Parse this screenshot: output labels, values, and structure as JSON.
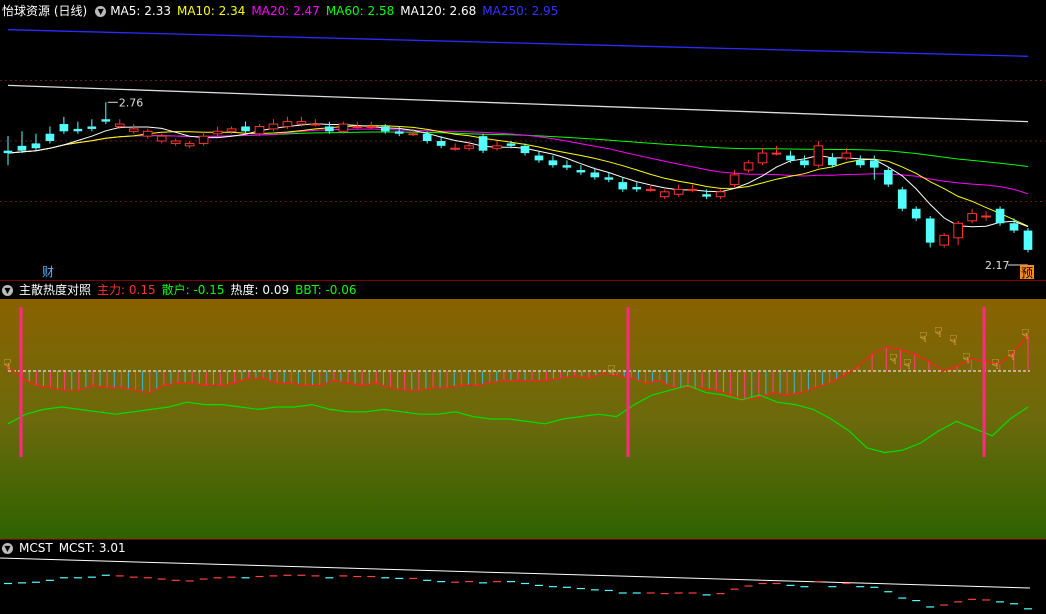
{
  "main": {
    "title": "怡球资源 (日线)",
    "ma": [
      {
        "label": "MA5: 2.33",
        "color": "#ffffff"
      },
      {
        "label": "MA10: 2.34",
        "color": "#ffff00"
      },
      {
        "label": "MA20: 2.47",
        "color": "#ff00ff"
      },
      {
        "label": "MA60: 2.58",
        "color": "#00ff00"
      },
      {
        "label": "MA120: 2.68",
        "color": "#ffffff"
      },
      {
        "label": "MA250: 2.95",
        "color": "#3333ff"
      }
    ],
    "high_label": "2.76",
    "low_label": "2.17",
    "fin_badge": "财",
    "pre_badge": "预"
  },
  "indicator": {
    "title": "主散热度对照",
    "items": [
      {
        "label": "主力: 0.15",
        "color": "#ff3333"
      },
      {
        "label": "散户: -0.15",
        "color": "#00ff00"
      },
      {
        "label": "热度: 0.09",
        "color": "#ffffff"
      },
      {
        "label": "BBT: -0.06",
        "color": "#00ff00"
      }
    ]
  },
  "mcst": {
    "title": "MCST",
    "value_label": "MCST: 3.01"
  },
  "chart_data": [
    {
      "type": "candlestick",
      "title": "怡球资源 (日线)",
      "ylim": [
        2.1,
        3.1
      ],
      "candles": [
        [
          2.56,
          2.55,
          2.62,
          2.5
        ],
        [
          2.58,
          2.56,
          2.64,
          2.55
        ],
        [
          2.59,
          2.57,
          2.63,
          2.56
        ],
        [
          2.63,
          2.6,
          2.66,
          2.59
        ],
        [
          2.67,
          2.64,
          2.7,
          2.63
        ],
        [
          2.65,
          2.64,
          2.68,
          2.63
        ],
        [
          2.66,
          2.65,
          2.69,
          2.64
        ],
        [
          2.69,
          2.68,
          2.76,
          2.67
        ],
        [
          2.66,
          2.67,
          2.69,
          2.65
        ],
        [
          2.64,
          2.65,
          2.67,
          2.63
        ],
        [
          2.62,
          2.64,
          2.65,
          2.61
        ],
        [
          2.6,
          2.62,
          2.63,
          2.59
        ],
        [
          2.59,
          2.6,
          2.61,
          2.58
        ],
        [
          2.58,
          2.59,
          2.6,
          2.57
        ],
        [
          2.59,
          2.62,
          2.64,
          2.58
        ],
        [
          2.63,
          2.64,
          2.66,
          2.62
        ],
        [
          2.64,
          2.65,
          2.66,
          2.63
        ],
        [
          2.66,
          2.64,
          2.68,
          2.63
        ],
        [
          2.63,
          2.66,
          2.67,
          2.62
        ],
        [
          2.65,
          2.67,
          2.69,
          2.64
        ],
        [
          2.66,
          2.68,
          2.7,
          2.65
        ],
        [
          2.67,
          2.68,
          2.7,
          2.66
        ],
        [
          2.67,
          2.67,
          2.69,
          2.66
        ],
        [
          2.66,
          2.64,
          2.68,
          2.63
        ],
        [
          2.64,
          2.67,
          2.68,
          2.63
        ],
        [
          2.66,
          2.66,
          2.68,
          2.65
        ],
        [
          2.66,
          2.66,
          2.68,
          2.65
        ],
        [
          2.66,
          2.64,
          2.67,
          2.63
        ],
        [
          2.64,
          2.63,
          2.66,
          2.62
        ],
        [
          2.63,
          2.63,
          2.65,
          2.62
        ],
        [
          2.63,
          2.6,
          2.64,
          2.59
        ],
        [
          2.6,
          2.58,
          2.62,
          2.57
        ],
        [
          2.57,
          2.57,
          2.59,
          2.56
        ],
        [
          2.57,
          2.58,
          2.6,
          2.56
        ],
        [
          2.62,
          2.56,
          2.63,
          2.55
        ],
        [
          2.57,
          2.58,
          2.6,
          2.56
        ],
        [
          2.59,
          2.58,
          2.6,
          2.57
        ],
        [
          2.58,
          2.55,
          2.59,
          2.54
        ],
        [
          2.54,
          2.52,
          2.56,
          2.51
        ],
        [
          2.52,
          2.5,
          2.54,
          2.49
        ],
        [
          2.5,
          2.49,
          2.52,
          2.48
        ],
        [
          2.48,
          2.47,
          2.5,
          2.46
        ],
        [
          2.47,
          2.45,
          2.49,
          2.44
        ],
        [
          2.45,
          2.44,
          2.47,
          2.43
        ],
        [
          2.43,
          2.4,
          2.45,
          2.39
        ],
        [
          2.41,
          2.4,
          2.43,
          2.39
        ],
        [
          2.4,
          2.4,
          2.42,
          2.39
        ],
        [
          2.37,
          2.39,
          2.4,
          2.36
        ],
        [
          2.38,
          2.4,
          2.42,
          2.37
        ],
        [
          2.4,
          2.4,
          2.42,
          2.39
        ],
        [
          2.38,
          2.37,
          2.4,
          2.36
        ],
        [
          2.37,
          2.39,
          2.4,
          2.36
        ],
        [
          2.42,
          2.46,
          2.48,
          2.41
        ],
        [
          2.48,
          2.51,
          2.52,
          2.47
        ],
        [
          2.51,
          2.55,
          2.57,
          2.5
        ],
        [
          2.55,
          2.55,
          2.58,
          2.54
        ],
        [
          2.54,
          2.52,
          2.56,
          2.51
        ],
        [
          2.52,
          2.5,
          2.54,
          2.49
        ],
        [
          2.5,
          2.58,
          2.6,
          2.49
        ],
        [
          2.53,
          2.5,
          2.55,
          2.49
        ],
        [
          2.53,
          2.55,
          2.57,
          2.52
        ],
        [
          2.52,
          2.5,
          2.54,
          2.49
        ],
        [
          2.52,
          2.49,
          2.54,
          2.44
        ],
        [
          2.48,
          2.42,
          2.49,
          2.41
        ],
        [
          2.4,
          2.32,
          2.41,
          2.31
        ],
        [
          2.32,
          2.28,
          2.33,
          2.27
        ],
        [
          2.28,
          2.18,
          2.29,
          2.16
        ],
        [
          2.17,
          2.21,
          2.22,
          2.16
        ],
        [
          2.2,
          2.26,
          2.27,
          2.17
        ],
        [
          2.27,
          2.3,
          2.32,
          2.26
        ],
        [
          2.29,
          2.29,
          2.31,
          2.27
        ],
        [
          2.32,
          2.26,
          2.33,
          2.25
        ],
        [
          2.26,
          2.23,
          2.28,
          2.22
        ],
        [
          2.23,
          2.15,
          2.24,
          2.14
        ]
      ],
      "ma_lines": [
        {
          "name": "MA250",
          "values_start": 3.06,
          "values_end": 2.95
        },
        {
          "name": "MA120",
          "values_start": 2.83,
          "values_end": 2.68
        }
      ]
    },
    {
      "type": "line",
      "title": "主散热度对照",
      "series": [
        {
          "name": "主力",
          "values": [
            0.02,
            -0.03,
            -0.06,
            -0.07,
            -0.08,
            -0.08,
            -0.06,
            -0.07,
            -0.07,
            -0.08,
            -0.09,
            -0.06,
            -0.05,
            -0.05,
            -0.06,
            -0.06,
            -0.05,
            -0.03,
            -0.03,
            -0.05,
            -0.05,
            -0.06,
            -0.06,
            -0.04,
            -0.05,
            -0.06,
            -0.05,
            -0.07,
            -0.08,
            -0.08,
            -0.07,
            -0.07,
            -0.06,
            -0.06,
            -0.05,
            -0.04,
            -0.04,
            -0.04,
            -0.04,
            -0.03,
            -0.02,
            -0.03,
            -0.01,
            -0.02,
            -0.03,
            -0.05,
            -0.04,
            -0.07,
            -0.07,
            -0.07,
            -0.08,
            -0.1,
            -0.12,
            -0.11,
            -0.09,
            -0.1,
            -0.09,
            -0.07,
            -0.05,
            -0.02,
            0.02,
            0.07,
            0.1,
            0.09,
            0.07,
            0.04,
            0.0,
            0.02,
            0.05,
            0.04,
            0.03,
            0.08,
            0.15
          ]
        },
        {
          "name": "散户",
          "values": [
            -0.22,
            -0.18,
            -0.16,
            -0.15,
            -0.16,
            -0.17,
            -0.18,
            -0.17,
            -0.16,
            -0.15,
            -0.13,
            -0.14,
            -0.14,
            -0.15,
            -0.16,
            -0.15,
            -0.15,
            -0.14,
            -0.16,
            -0.17,
            -0.17,
            -0.16,
            -0.17,
            -0.18,
            -0.18,
            -0.17,
            -0.19,
            -0.2,
            -0.2,
            -0.21,
            -0.22,
            -0.2,
            -0.19,
            -0.18,
            -0.19,
            -0.14,
            -0.1,
            -0.08,
            -0.06,
            -0.09,
            -0.1,
            -0.12,
            -0.1,
            -0.13,
            -0.14,
            -0.16,
            -0.2,
            -0.25,
            -0.32,
            -0.34,
            -0.33,
            -0.3,
            -0.25,
            -0.21,
            -0.24,
            -0.27,
            -0.2,
            -0.15
          ]
        },
        {
          "name": "热度",
          "values": [
            0.0
          ]
        }
      ]
    },
    {
      "type": "line",
      "title": "MCST",
      "series": [
        {
          "name": "MCST",
          "values_start": 3.04,
          "values_end": 3.01
        }
      ]
    }
  ]
}
